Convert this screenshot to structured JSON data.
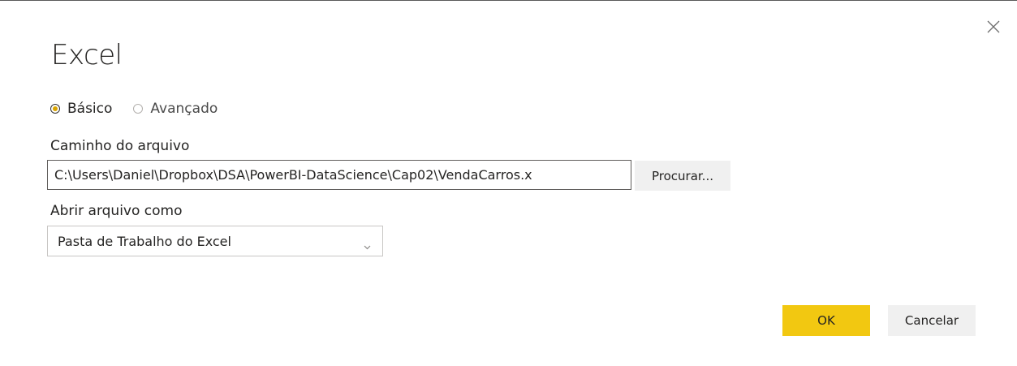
{
  "dialog": {
    "title": "Excel",
    "close_icon": "close-icon"
  },
  "mode": {
    "options": [
      {
        "label": "Básico",
        "selected": true
      },
      {
        "label": "Avançado",
        "selected": false
      }
    ],
    "accent_color": "#d9a400"
  },
  "file_path": {
    "label": "Caminho do arquivo",
    "value": "C:\\Users\\Daniel\\Dropbox\\DSA\\PowerBI-DataScience\\Cap02\\VendaCarros.x",
    "browse_label": "Procurar..."
  },
  "open_as": {
    "label": "Abrir arquivo como",
    "selected": "Pasta de Trabalho do Excel",
    "arrow_icon": "chevron-down-icon"
  },
  "actions": {
    "ok_label": "OK",
    "ok_color": "#f2c811",
    "cancel_label": "Cancelar"
  }
}
